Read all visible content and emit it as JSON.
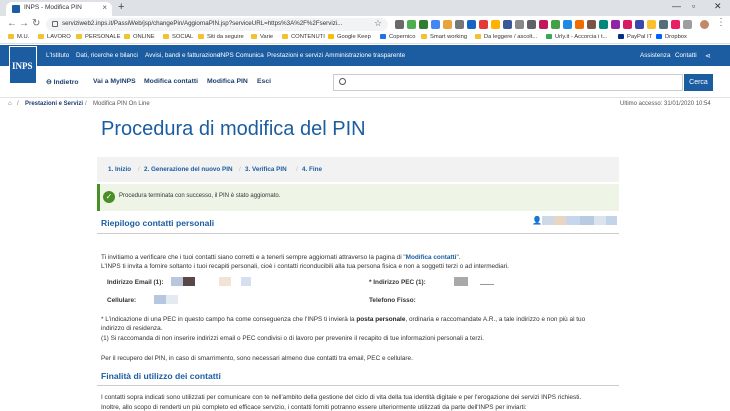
{
  "browser": {
    "tab_title": "INPS - Modifica PIN",
    "tab_close": "×",
    "new_tab": "+",
    "url": "serviziweb2.inps.it/PassiWeb/jsp/changePin/AggiornaPIN.jsp?serviceURL=https%3A%2F%2Fservizi...",
    "bookmarks": [
      "M.U.",
      "LAVORO",
      "PERSONALE",
      "ONLINE",
      "SOCIAL",
      "Siti da seguire",
      "Varie",
      "CONTENUTI",
      "Google Keep",
      "Copernico",
      "Smart working",
      "Da leggere / ascolt...",
      "Urly.it - Accorcia i t...",
      "PayPal IT",
      "Dropbox"
    ]
  },
  "inps": {
    "logo": "INPS",
    "topnav": [
      "L'Istituto",
      "Dati, ricerche e bilanci",
      "Avvisi, bandi e fatturazione",
      "INPS Comunica",
      "Prestazioni e servizi",
      "Amministrazione trasparente"
    ],
    "topnav_right": [
      "Assistenza",
      "Contatti"
    ],
    "subnav": [
      "Indietro",
      "Vai a MyINPS",
      "Modifica contatti",
      "Modifica PIN",
      "Esci"
    ],
    "search_button": "Cerca"
  },
  "breadcrumb": {
    "items": [
      "Prestazioni e Servizi",
      "Modifica PIN On Line"
    ],
    "last_access": "Ultimo accesso: 31/01/2020 10:54"
  },
  "page": {
    "title": "Procedura di modifica del PIN",
    "steps": [
      "1. Inizio",
      "2. Generazione del nuovo PIN",
      "3. Verifica PIN",
      "4. Fine"
    ],
    "success_message": "Procedura terminata con successo, il PIN è stato aggiornato.",
    "summary_heading": "Riepilogo contatti personali",
    "intro_1a": "Ti invitiamo a verificare che i tuoi contatti siano corretti e a tenerli sempre aggiornati attraverso la pagina di \"",
    "intro_1_link": "Modifica contatti",
    "intro_1b": "\".",
    "intro_2": "L'INPS ti invita a fornire soltanto i tuoi recapiti personali, cioè i contatti riconducibili alla tua persona fisica e non a soggetti terzi o ad intermediari.",
    "label_email": "Indirizzo Email (1):",
    "label_pec": "* Indirizzo PEC (1):",
    "label_cell": "Cellulare:",
    "label_phone": "Telefono Fisso:",
    "note_1a": "* L'indicazione di una PEC in questo campo ha come conseguenza che l'INPS ti invierà la ",
    "note_1_bold": "posta personale",
    "note_1b": ", ordinaria e raccomandate A.R., a tale indirizzo e non più al tuo",
    "note_1c": "indirizzo di residenza.",
    "note_2": "(1) Si raccomanda di non inserire indirizzi email o PEC condivisi o di lavoro per prevenire il recapito di tue informazioni personali a terzi.",
    "note_3": "Per il recupero del PIN, in caso di smarrimento, sono necessari almeno due contatti tra email, PEC e cellulare.",
    "purpose_heading": "Finalità di utilizzo dei contatti",
    "purpose_1": "I contatti sopra indicati sono utilizzati per comunicare con te nell'ambito della gestione del ciclo di vita della tua identità digitale e per l'erogazione dei servizi INPS richiesti.",
    "purpose_2": "Inoltre, allo scopo di renderti un più completo ed efficace servizio, i contatti forniti potranno essere ulteriormente utilizzati da parte dell'INPS per inviarti:"
  },
  "colors": {
    "brand": "#1c5da2",
    "success": "#4a8f26"
  }
}
